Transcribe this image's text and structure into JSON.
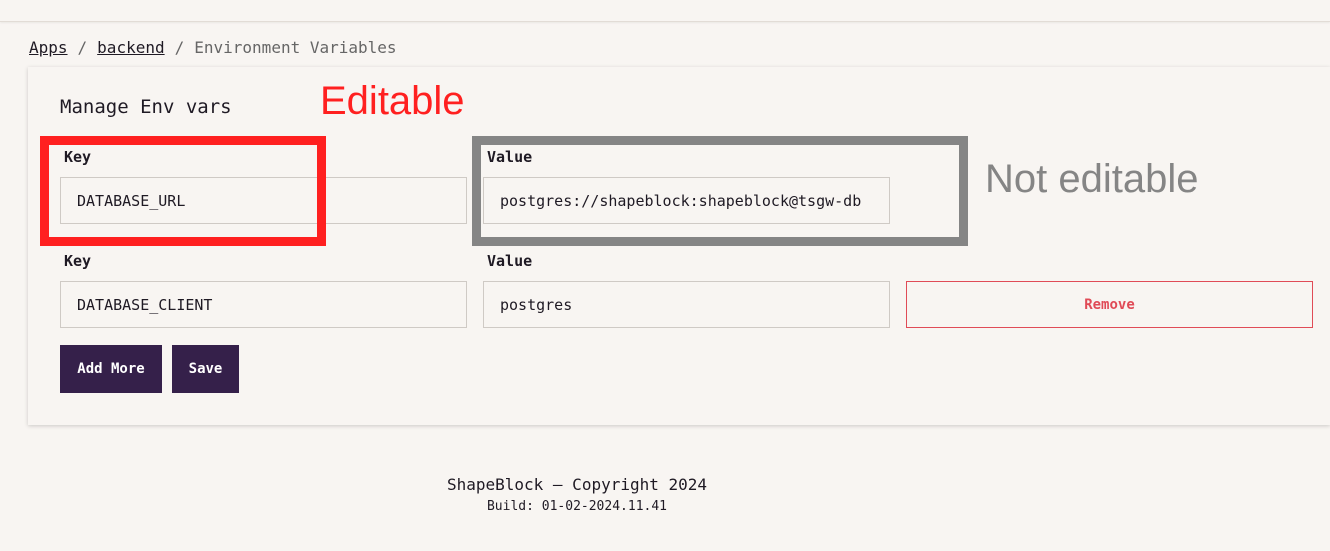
{
  "breadcrumb": {
    "items": [
      {
        "label": "Apps"
      },
      {
        "label": "backend"
      },
      {
        "label": "Environment Variables"
      }
    ],
    "separator": "/"
  },
  "card": {
    "title": "Manage Env vars",
    "rows": [
      {
        "key_label": "Key",
        "key_value": "DATABASE_URL",
        "value_label": "Value",
        "value_value": "postgres://shapeblock:shapeblock@tsgw-db"
      },
      {
        "key_label": "Key",
        "key_value": "DATABASE_CLIENT",
        "value_label": "Value",
        "value_value": "postgres",
        "remove_label": "Remove"
      }
    ],
    "add_more_label": "Add More",
    "save_label": "Save"
  },
  "annotations": {
    "editable": "Editable",
    "not_editable": "Not editable",
    "editable_color": "#ff2020",
    "not_editable_color": "#858585"
  },
  "footer": {
    "copyright": "ShapeBlock — Copyright 2024",
    "build": "Build: 01-02-2024.11.41"
  },
  "colors": {
    "primary": "#35204a",
    "danger": "#e04b57",
    "background": "#f8f5f2"
  }
}
